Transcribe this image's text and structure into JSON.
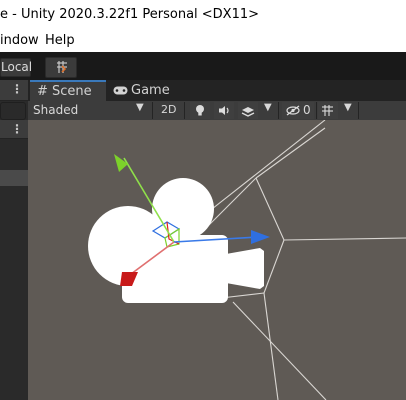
{
  "window": {
    "title": "e - Unity 2020.3.22f1 Personal <DX11>"
  },
  "menu": {
    "items": [
      "indow",
      "Help"
    ]
  },
  "toolbar": {
    "pivot_rotation_label": "Local"
  },
  "tabs": [
    {
      "label": "Scene",
      "icon": "grid-icon",
      "active": true
    },
    {
      "label": "Game",
      "icon": "gamepad-icon",
      "active": false
    }
  ],
  "scene_toolbar": {
    "draw_mode": "Shaded",
    "mode_2d_label": "2D",
    "hidden_objects_count": "0"
  },
  "colors": {
    "accent": "#3a79bb",
    "gizmo_x": "#e02020",
    "gizmo_y": "#7cd12a",
    "gizmo_z": "#2f6fe0",
    "viewport_bg": "#5f5a55"
  }
}
